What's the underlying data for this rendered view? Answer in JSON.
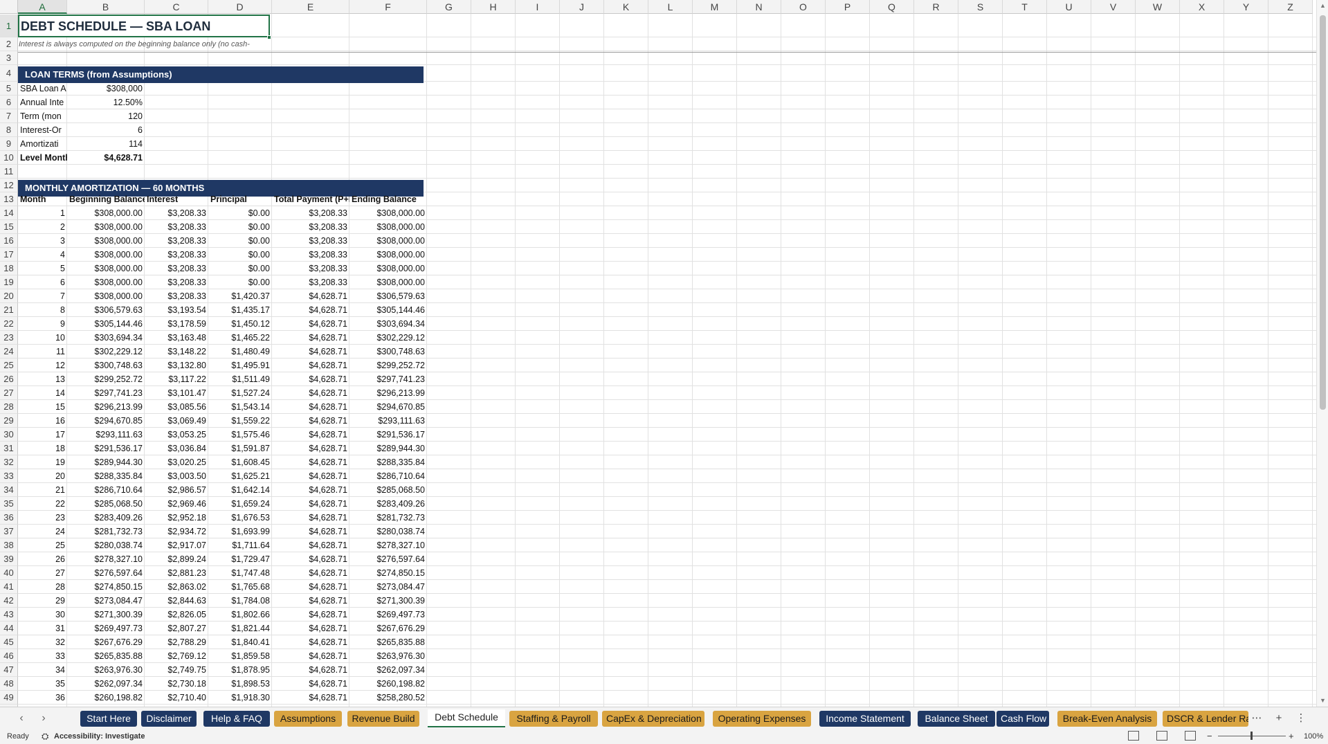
{
  "columns": [
    "A",
    "B",
    "C",
    "D",
    "E",
    "F",
    "G",
    "H",
    "I",
    "J",
    "K",
    "L",
    "M",
    "N",
    "O",
    "P",
    "Q",
    "R",
    "S",
    "T",
    "U",
    "V",
    "W",
    "X",
    "Y",
    "Z"
  ],
  "sheet": {
    "title": "DEBT SCHEDULE — SBA LOAN",
    "subtitle": "Interest is always computed on the beginning balance only (no cash-",
    "loan_terms_header": "LOAN TERMS (from Assumptions)",
    "loan_terms": [
      {
        "label": "SBA Loan A",
        "value": "$308,000"
      },
      {
        "label": "Annual Inte",
        "value": "12.50%"
      },
      {
        "label": "Term (mon",
        "value": "120"
      },
      {
        "label": "Interest-Or",
        "value": "6"
      },
      {
        "label": "Amortizati",
        "value": "114"
      },
      {
        "label": "Level Month",
        "value": "$4,628.71"
      }
    ],
    "amort_header": "MONTHLY AMORTIZATION — 60 MONTHS",
    "table_headers": [
      "Month",
      "Beginning Balance",
      "Interest",
      "Principal",
      "Total Payment (P+I)",
      "Ending Balance"
    ],
    "rows": [
      [
        "1",
        "$308,000.00",
        "$3,208.33",
        "$0.00",
        "$3,208.33",
        "$308,000.00"
      ],
      [
        "2",
        "$308,000.00",
        "$3,208.33",
        "$0.00",
        "$3,208.33",
        "$308,000.00"
      ],
      [
        "3",
        "$308,000.00",
        "$3,208.33",
        "$0.00",
        "$3,208.33",
        "$308,000.00"
      ],
      [
        "4",
        "$308,000.00",
        "$3,208.33",
        "$0.00",
        "$3,208.33",
        "$308,000.00"
      ],
      [
        "5",
        "$308,000.00",
        "$3,208.33",
        "$0.00",
        "$3,208.33",
        "$308,000.00"
      ],
      [
        "6",
        "$308,000.00",
        "$3,208.33",
        "$0.00",
        "$3,208.33",
        "$308,000.00"
      ],
      [
        "7",
        "$308,000.00",
        "$3,208.33",
        "$1,420.37",
        "$4,628.71",
        "$306,579.63"
      ],
      [
        "8",
        "$306,579.63",
        "$3,193.54",
        "$1,435.17",
        "$4,628.71",
        "$305,144.46"
      ],
      [
        "9",
        "$305,144.46",
        "$3,178.59",
        "$1,450.12",
        "$4,628.71",
        "$303,694.34"
      ],
      [
        "10",
        "$303,694.34",
        "$3,163.48",
        "$1,465.22",
        "$4,628.71",
        "$302,229.12"
      ],
      [
        "11",
        "$302,229.12",
        "$3,148.22",
        "$1,480.49",
        "$4,628.71",
        "$300,748.63"
      ],
      [
        "12",
        "$300,748.63",
        "$3,132.80",
        "$1,495.91",
        "$4,628.71",
        "$299,252.72"
      ],
      [
        "13",
        "$299,252.72",
        "$3,117.22",
        "$1,511.49",
        "$4,628.71",
        "$297,741.23"
      ],
      [
        "14",
        "$297,741.23",
        "$3,101.47",
        "$1,527.24",
        "$4,628.71",
        "$296,213.99"
      ],
      [
        "15",
        "$296,213.99",
        "$3,085.56",
        "$1,543.14",
        "$4,628.71",
        "$294,670.85"
      ],
      [
        "16",
        "$294,670.85",
        "$3,069.49",
        "$1,559.22",
        "$4,628.71",
        "$293,111.63"
      ],
      [
        "17",
        "$293,111.63",
        "$3,053.25",
        "$1,575.46",
        "$4,628.71",
        "$291,536.17"
      ],
      [
        "18",
        "$291,536.17",
        "$3,036.84",
        "$1,591.87",
        "$4,628.71",
        "$289,944.30"
      ],
      [
        "19",
        "$289,944.30",
        "$3,020.25",
        "$1,608.45",
        "$4,628.71",
        "$288,335.84"
      ],
      [
        "20",
        "$288,335.84",
        "$3,003.50",
        "$1,625.21",
        "$4,628.71",
        "$286,710.64"
      ],
      [
        "21",
        "$286,710.64",
        "$2,986.57",
        "$1,642.14",
        "$4,628.71",
        "$285,068.50"
      ],
      [
        "22",
        "$285,068.50",
        "$2,969.46",
        "$1,659.24",
        "$4,628.71",
        "$283,409.26"
      ],
      [
        "23",
        "$283,409.26",
        "$2,952.18",
        "$1,676.53",
        "$4,628.71",
        "$281,732.73"
      ],
      [
        "24",
        "$281,732.73",
        "$2,934.72",
        "$1,693.99",
        "$4,628.71",
        "$280,038.74"
      ],
      [
        "25",
        "$280,038.74",
        "$2,917.07",
        "$1,711.64",
        "$4,628.71",
        "$278,327.10"
      ],
      [
        "26",
        "$278,327.10",
        "$2,899.24",
        "$1,729.47",
        "$4,628.71",
        "$276,597.64"
      ],
      [
        "27",
        "$276,597.64",
        "$2,881.23",
        "$1,747.48",
        "$4,628.71",
        "$274,850.15"
      ],
      [
        "28",
        "$274,850.15",
        "$2,863.02",
        "$1,765.68",
        "$4,628.71",
        "$273,084.47"
      ],
      [
        "29",
        "$273,084.47",
        "$2,844.63",
        "$1,784.08",
        "$4,628.71",
        "$271,300.39"
      ],
      [
        "30",
        "$271,300.39",
        "$2,826.05",
        "$1,802.66",
        "$4,628.71",
        "$269,497.73"
      ],
      [
        "31",
        "$269,497.73",
        "$2,807.27",
        "$1,821.44",
        "$4,628.71",
        "$267,676.29"
      ],
      [
        "32",
        "$267,676.29",
        "$2,788.29",
        "$1,840.41",
        "$4,628.71",
        "$265,835.88"
      ],
      [
        "33",
        "$265,835.88",
        "$2,769.12",
        "$1,859.58",
        "$4,628.71",
        "$263,976.30"
      ],
      [
        "34",
        "$263,976.30",
        "$2,749.75",
        "$1,878.95",
        "$4,628.71",
        "$262,097.34"
      ],
      [
        "35",
        "$262,097.34",
        "$2,730.18",
        "$1,898.53",
        "$4,628.71",
        "$260,198.82"
      ],
      [
        "36",
        "$260,198.82",
        "$2,710.40",
        "$1,918.30",
        "$4,628.71",
        "$258,280.52"
      ]
    ]
  },
  "tabs": [
    {
      "label": "Start Here",
      "style": "navy"
    },
    {
      "label": "Disclaimer",
      "style": "navy"
    },
    {
      "label": "Help & FAQ",
      "style": "navy"
    },
    {
      "label": "Assumptions",
      "style": "gold"
    },
    {
      "label": "Revenue Build",
      "style": "gold"
    },
    {
      "label": "Debt Schedule",
      "style": "active"
    },
    {
      "label": "Staffing & Payroll",
      "style": "gold"
    },
    {
      "label": "CapEx & Depreciation",
      "style": "gold"
    },
    {
      "label": "Operating Expenses",
      "style": "gold"
    },
    {
      "label": "Income Statement",
      "style": "navy"
    },
    {
      "label": "Balance Sheet",
      "style": "navy"
    },
    {
      "label": "Cash Flow",
      "style": "navy"
    },
    {
      "label": "Break-Even Analysis",
      "style": "gold"
    },
    {
      "label": "DSCR & Lender Ra",
      "style": "gold"
    }
  ],
  "tab_controls": {
    "more": "⋯",
    "add": "+",
    "options": "⋮",
    "prev": "‹",
    "next": "›"
  },
  "status": {
    "ready": "Ready",
    "accessibility": "Accessibility: Investigate",
    "zoom_minus": "−",
    "zoom_plus": "+",
    "zoom": "100%"
  },
  "colors": {
    "navy": "#1f3864",
    "gold": "#d9a441",
    "excel_green": "#217346"
  }
}
